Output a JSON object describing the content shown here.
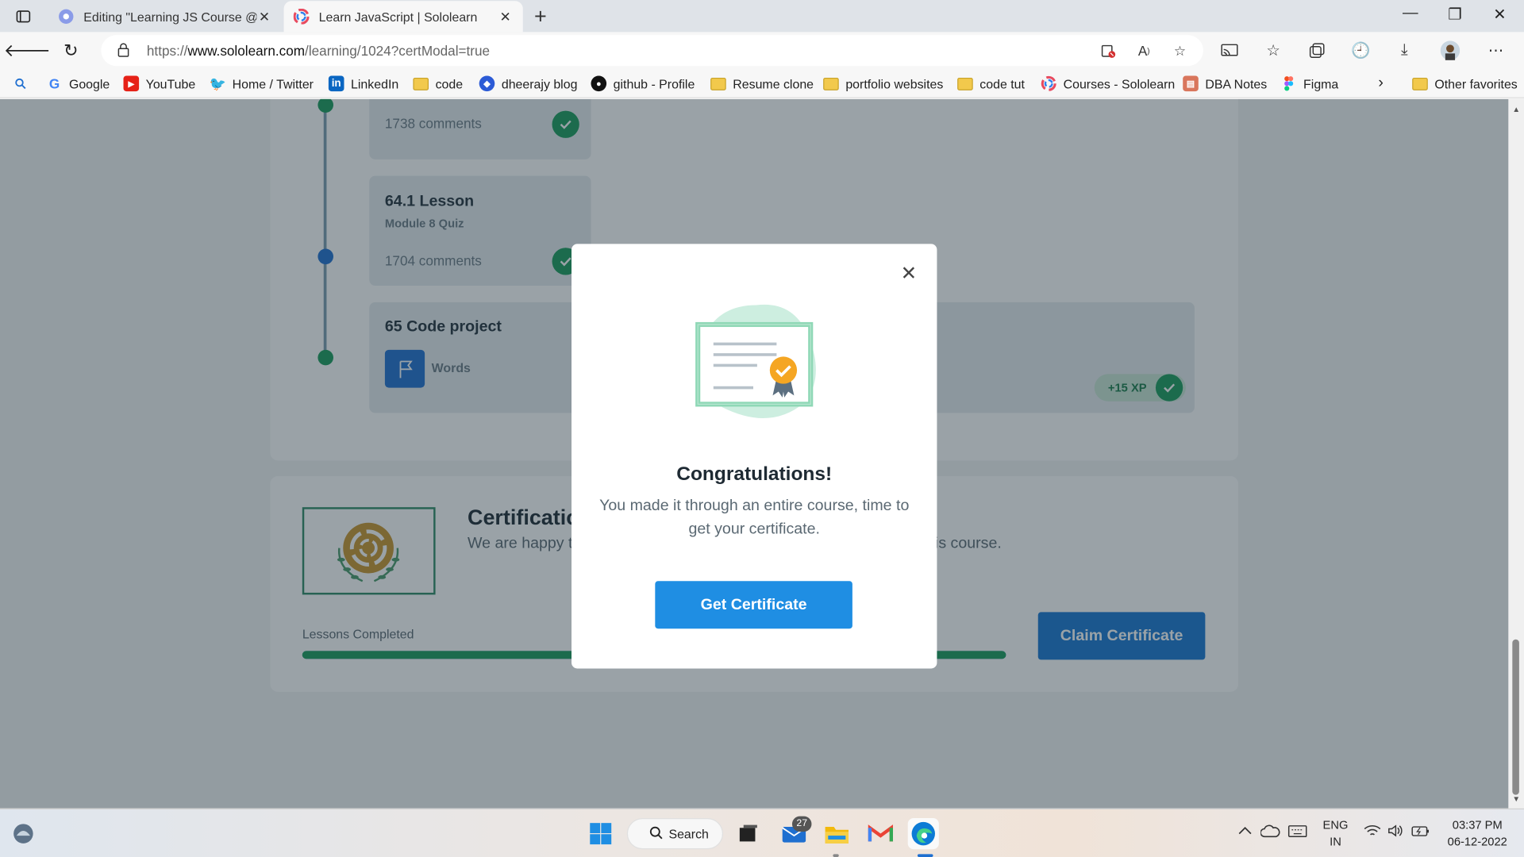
{
  "browser": {
    "tabs": [
      {
        "title": "Editing \"Learning JS Course @Sc",
        "active": false
      },
      {
        "title": "Learn JavaScript | Sololearn",
        "active": true
      }
    ],
    "url_prefix": "https://",
    "url_domain": "www.sololearn.com",
    "url_path": "/learning/1024?certModal=true",
    "favorites": [
      {
        "label": "Google",
        "icon": "google-icon"
      },
      {
        "label": "YouTube",
        "icon": "youtube-icon"
      },
      {
        "label": "Home / Twitter",
        "icon": "twitter-icon"
      },
      {
        "label": "LinkedIn",
        "icon": "linkedin-icon"
      },
      {
        "label": "code",
        "icon": "folder-icon"
      },
      {
        "label": "dheerajy blog",
        "icon": "blog-icon"
      },
      {
        "label": "github - Profile",
        "icon": "github-icon"
      },
      {
        "label": "Resume clone",
        "icon": "folder-icon"
      },
      {
        "label": "portfolio websites",
        "icon": "folder-icon"
      },
      {
        "label": "code tut",
        "icon": "folder-icon"
      },
      {
        "label": "Courses - Sololearn",
        "icon": "sololearn-icon"
      },
      {
        "label": "DBA Notes",
        "icon": "notes-icon"
      },
      {
        "label": "Figma",
        "icon": "figma-icon"
      }
    ],
    "other_favorites": "Other favorites"
  },
  "page": {
    "lessons": [
      {
        "name": "",
        "sub": "",
        "comments": "1738 comments",
        "done": true
      },
      {
        "name": "64.1 Lesson",
        "sub": "Module 8 Quiz",
        "comments": "1704 comments",
        "done": true
      },
      {
        "name": "65 Code project",
        "project": "Words",
        "xp": "+15 XP",
        "done": true
      }
    ],
    "certification": {
      "title": "Certification",
      "text_start": "We are happy t",
      "text_end": "is course.",
      "lessons_label": "Lessons Completed",
      "progress": 1.0,
      "claim_label": "Claim Certificate"
    }
  },
  "modal": {
    "title": "Congratulations!",
    "message": "You made it through an entire course, time to get your certificate.",
    "button": "Get Certificate"
  },
  "taskbar": {
    "search": "Search",
    "mail_badge": "27",
    "lang_line1": "ENG",
    "lang_line2": "IN",
    "time": "03:37 PM",
    "date": "06-12-2022"
  },
  "colors": {
    "accent": "#1f8ee3",
    "success": "#1a9c5b",
    "claim": "#1877d2"
  }
}
